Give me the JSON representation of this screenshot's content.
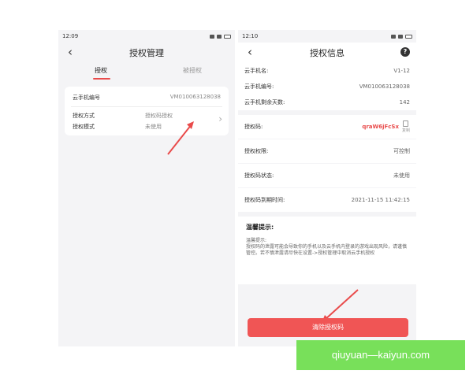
{
  "screen1": {
    "status_time": "12:09",
    "title": "授权管理",
    "tabs": [
      {
        "label": "授权",
        "active": true
      },
      {
        "label": "被授权",
        "active": false
      }
    ],
    "card": {
      "phone_id_label": "云手机编号",
      "phone_id_value": "VM010063128038",
      "method_label": "授权方式",
      "method_value": "授权码授权",
      "mode_label": "授权模式",
      "mode_value": "未使用"
    }
  },
  "screen2": {
    "status_time": "12:10",
    "title": "授权信息",
    "help_icon": "?",
    "rows": [
      {
        "label": "云手机名:",
        "value": "V1-12"
      },
      {
        "label": "云手机编号:",
        "value": "VM010063128038"
      },
      {
        "label": "云手机剩余天数:",
        "value": "142"
      }
    ],
    "auth_code_label": "授权码:",
    "auth_code_value": "qraW6jFcSx",
    "copy_label": "复制",
    "permission_label": "授权权限:",
    "permission_value": "可控制",
    "code_status_label": "授权码状态:",
    "code_status_value": "未使用",
    "expiry_label": "授权码到期时间:",
    "expiry_value": "2021-11-15 11:42:15",
    "tips_title": "温馨提示:",
    "tips_body": "温馨提示:\n授权码的泄露可能会导致你的手机以及云手机内登录的游戏出现风险，请谨慎管控。若不慎泄露请尽快在设置->授权管理中取消云手机授权",
    "clear_button": "清除授权码"
  },
  "watermark": "qiuyuan—kaiyun.com",
  "colors": {
    "accent": "#e94b4b",
    "button": "#f05555",
    "watermark_bg": "#78e05a"
  }
}
